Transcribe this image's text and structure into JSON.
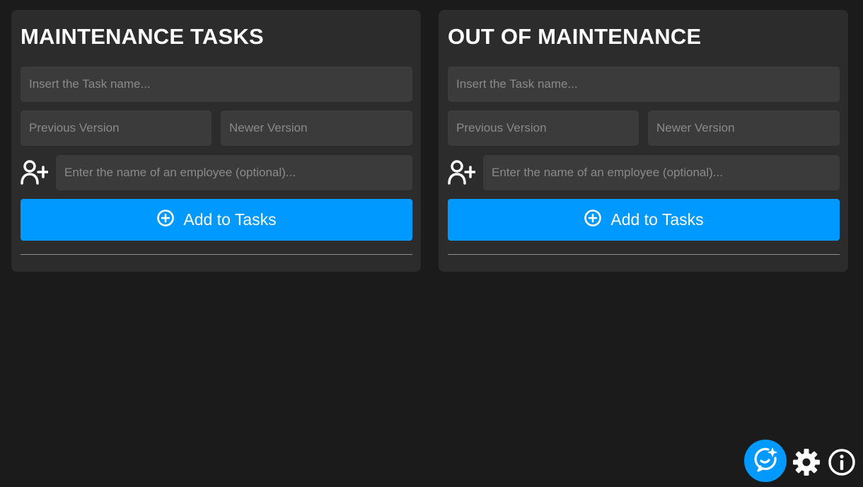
{
  "panels": [
    {
      "title": "MAINTENANCE TASKS",
      "task_placeholder": "Insert the Task name...",
      "previous_version_placeholder": "Previous Version",
      "newer_version_placeholder": "Newer Version",
      "employee_placeholder": "Enter the name of an employee (optional)...",
      "employee_icon": "person-add-icon",
      "button_icon": "plus-circle-icon",
      "button_label": "Add to Tasks"
    },
    {
      "title": "OUT OF MAINTENANCE",
      "task_placeholder": "Insert the Task name...",
      "previous_version_placeholder": "Previous Version",
      "newer_version_placeholder": "Newer Version",
      "employee_placeholder": "Enter the name of an employee (optional)...",
      "employee_icon": "person-add-icon",
      "button_icon": "plus-circle-icon",
      "button_label": "Add to Tasks"
    }
  ],
  "floating_actions": {
    "assistant_icon": "assistant-sparkle-icon",
    "settings_icon": "gear-icon",
    "info_icon": "info-icon"
  },
  "colors": {
    "background": "#1b1b1b",
    "panel": "#2c2c2c",
    "input": "#3b3b3b",
    "accent": "#0099ff",
    "placeholder": "#8a8a8a"
  }
}
